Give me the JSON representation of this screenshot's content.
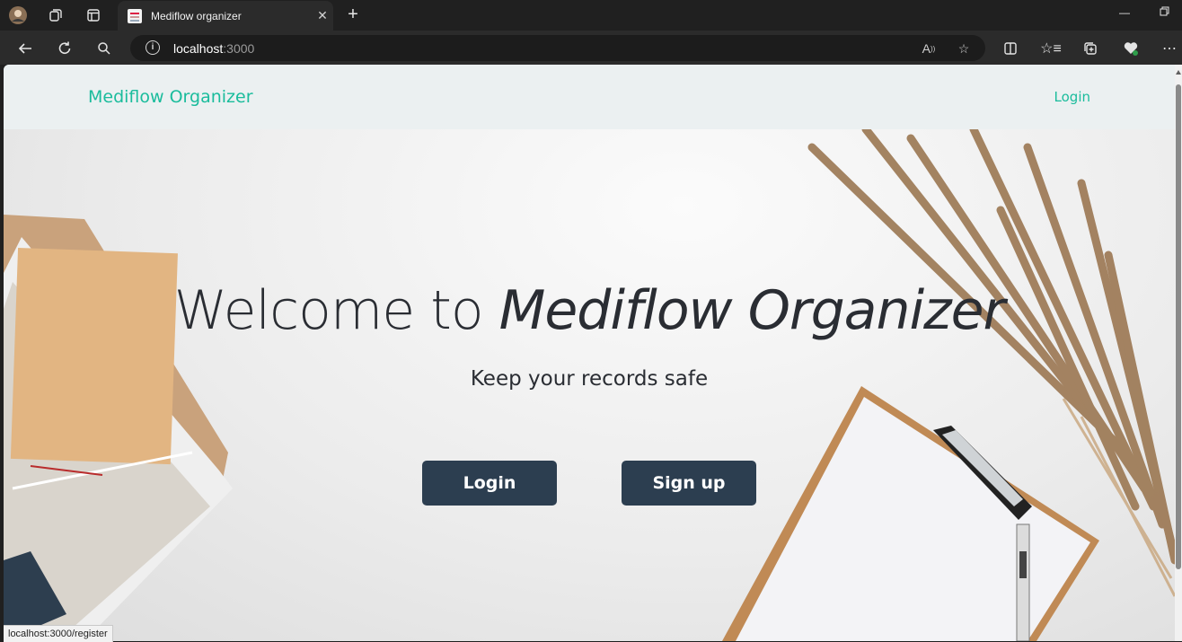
{
  "browser": {
    "tab_title": "Mediflow organizer",
    "url_host": "localhost",
    "url_port": ":3000",
    "status_text": "localhost:3000/register"
  },
  "navbar": {
    "brand": "Mediflow Organizer",
    "login_link": "Login"
  },
  "hero": {
    "heading_prefix": "Welcome to ",
    "heading_emphasis": "Mediflow Organizer",
    "subheading": "Keep your records safe",
    "login_button": "Login",
    "signup_button": "Sign up"
  },
  "colors": {
    "brand": "#1abc9c",
    "button": "#2c3e50",
    "navbar_bg": "#ebf0f1"
  },
  "icons": [
    "profile-icon",
    "workspaces-icon",
    "tab-actions-icon",
    "close-tab-icon",
    "new-tab-icon",
    "minimize-icon",
    "restore-icon",
    "back-icon",
    "refresh-icon",
    "search-icon",
    "info-icon",
    "read-aloud-icon",
    "favorite-icon",
    "split-screen-icon",
    "favorites-icon",
    "collections-icon",
    "health-extension-icon",
    "more-icon"
  ]
}
